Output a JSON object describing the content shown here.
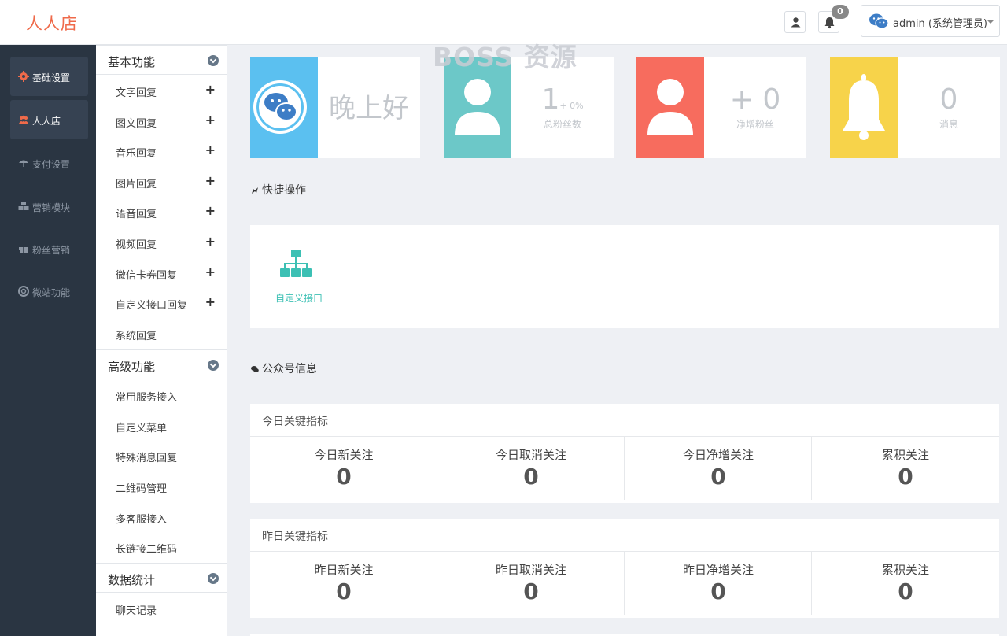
{
  "header": {
    "brand": "人人店",
    "watermark": "BOSS 资源",
    "notification_count": "0",
    "admin_label": "admin (系统管理员)"
  },
  "colors": {
    "accent": "#ef6a4a",
    "nav_bg": "#2a3542",
    "card_blue": "#5bc0f0",
    "card_teal": "#6cc8c8",
    "card_red": "#f76c5e",
    "card_yellow": "#f7d34a",
    "quick_icon": "#3cc0b4"
  },
  "nav": {
    "items": [
      {
        "label": "基础设置",
        "icon": "gear-icon"
      },
      {
        "label": "人人店",
        "icon": "users-icon"
      },
      {
        "label": "支付设置",
        "icon": "umbrella-icon"
      },
      {
        "label": "营销模块",
        "icon": "cubes-icon"
      },
      {
        "label": "粉丝营销",
        "icon": "gift-icon"
      },
      {
        "label": "微站功能",
        "icon": "lifebuoy-icon"
      }
    ]
  },
  "menu": {
    "basic": {
      "title": "基本功能",
      "items": [
        "文字回复",
        "图文回复",
        "音乐回复",
        "图片回复",
        "语音回复",
        "视频回复",
        "微信卡券回复",
        "自定义接口回复",
        "系统回复"
      ]
    },
    "advanced": {
      "title": "高级功能",
      "items": [
        "常用服务接入",
        "自定义菜单",
        "特殊消息回复",
        "二维码管理",
        "多客服接入",
        "长链接二维码"
      ]
    },
    "stats": {
      "title": "数据统计",
      "items": [
        "聊天记录"
      ]
    }
  },
  "cards": {
    "greeting": "晚上好",
    "fans": {
      "value": "1",
      "pct": "+ 0%",
      "label": "总粉丝数"
    },
    "net": {
      "value": "+ 0",
      "label": "净增粉丝"
    },
    "messages": {
      "value": "0",
      "label": "消息"
    }
  },
  "quick": {
    "title": "快捷操作",
    "items": [
      {
        "label": "自定义接口",
        "icon": "sitemap-icon"
      }
    ]
  },
  "account": {
    "title": "公众号信息",
    "today": {
      "title": "今日关键指标",
      "stats": [
        {
          "label": "今日新关注",
          "value": "0"
        },
        {
          "label": "今日取消关注",
          "value": "0"
        },
        {
          "label": "今日净增关注",
          "value": "0"
        },
        {
          "label": "累积关注",
          "value": "0"
        }
      ]
    },
    "yesterday": {
      "title": "昨日关键指标",
      "stats": [
        {
          "label": "昨日新关注",
          "value": "0"
        },
        {
          "label": "昨日取消关注",
          "value": "0"
        },
        {
          "label": "昨日净增关注",
          "value": "0"
        },
        {
          "label": "累积关注",
          "value": "0"
        }
      ]
    }
  }
}
